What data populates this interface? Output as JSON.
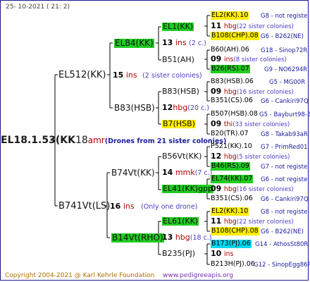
{
  "header": "25-  10-2021  (  21:   2)",
  "footer": {
    "copyright": "Copyright 2004-2021 @ Karl Kehrle Foundation",
    "url": "www.pedigreeapis.org"
  },
  "root": {
    "label": "EL18.1.53(KK",
    "num": "18",
    "sub": "amr",
    "info": "(Drones from 21 sister colonies)"
  },
  "gen1": [
    {
      "label": "EL512(KK)",
      "num": "15",
      "sub": "ins",
      "info": "(2 sister colonies)"
    },
    {
      "label": "B741Vt(LS)",
      "num": "16",
      "sub": "ins",
      "info": "(Only one drone)"
    }
  ],
  "gen2": [
    {
      "label": "EL84(KK)",
      "num": "13",
      "sub": "ins",
      "info": "(2 c.)"
    },
    {
      "label": "B83(HSB)",
      "num": "12",
      "sub": "hbg",
      "info": "(20 c.)"
    },
    {
      "label": "B74Vt(KK)",
      "num": "14",
      "sub": "mmk",
      "info": "(7 c.)"
    },
    {
      "label": "B14Vt(RHO)",
      "num": "13",
      "sub": "hbg",
      "info": "(18 c.)"
    }
  ],
  "gen3": [
    {
      "label": "EL1(KK)",
      "num": "11",
      "sub": "hbg",
      "info": "(22 sister colonies)"
    },
    {
      "label": "B51(AH)",
      "num": "09",
      "sub": "ins",
      "info": "(8 sister colonies)"
    },
    {
      "label": "B83(HSB)",
      "num": "09",
      "sub": "hbg",
      "info": "(16 sister colonies)"
    },
    {
      "label": "B7(HSB)",
      "num": "09",
      "sub": "thi",
      "info": "(33 sister colonies)"
    },
    {
      "label": "B56Vt(KK)",
      "num": "12",
      "sub": "hbg",
      "info": "(5 sister colonies)"
    },
    {
      "label": "EL41(KK)gpp",
      "num": "09",
      "sub": "hbg",
      "info": "(16 sister colonies)"
    },
    {
      "label": "EL61(KK)",
      "num": "11",
      "sub": "hbg",
      "info": "(22 sister colonies)"
    },
    {
      "label": "B235(PJ)",
      "num": "10",
      "sub": "ins",
      "info": ""
    }
  ],
  "gen4": [
    {
      "label": "EL2(KK).10",
      "info": "G8 - not registe"
    },
    {
      "label": "B108(CHP).08",
      "info": "G6 - B262(NE)"
    },
    {
      "label": "B60(AH).06",
      "info": "G18 - Sinop72R"
    },
    {
      "label": "B26(RS).07",
      "info": "G9 - NO6294R"
    },
    {
      "label": "B83(HSB).06",
      "info": "G5 - MG00R"
    },
    {
      "label": "B351(CS).06",
      "info": "G6 - Cankiri97Q"
    },
    {
      "label": "B507(HSB).08",
      "info": "G5 - Bayburt98-3"
    },
    {
      "label": "B20(TR).07",
      "info": "G8 - Takab93aR"
    },
    {
      "label": "P521(KK).10",
      "info": "G7 - PrimRed01"
    },
    {
      "label": "B46(RS).09",
      "info": "G7 - not registe"
    },
    {
      "label": "EL74(KK).07",
      "info": "G6 - not registe"
    },
    {
      "label": "B351(CS).06",
      "info": "G6 - Cankiri97Q"
    },
    {
      "label": "EL2(KK).10",
      "info": "G8 - not registe"
    },
    {
      "label": "B108(CHP).08",
      "info": "G6 - B262(NE)"
    },
    {
      "label": "B173(PJ).06",
      "info": "G14 - AthosSt80R"
    },
    {
      "label": "B213H(PJ).06",
      "info": "G12 - SinopEgg86R"
    }
  ]
}
